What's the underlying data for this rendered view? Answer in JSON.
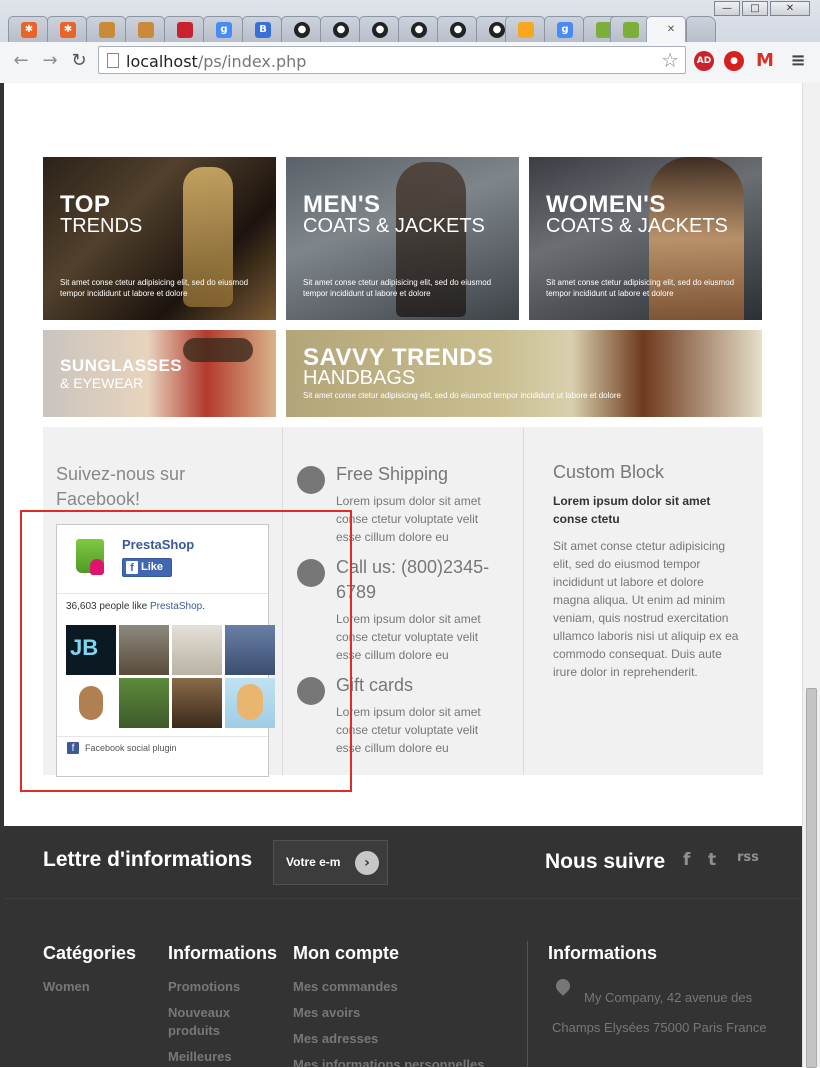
{
  "browser": {
    "url_host": "localhost",
    "url_path": "/ps/index.php",
    "tab_favicons": [
      "joomla",
      "joomla",
      "pma-folder",
      "pma-folder",
      "generic-red",
      "google",
      "blogger",
      "ghost",
      "ghost",
      "ghost",
      "ghost",
      "ghost",
      "ghost",
      "pma",
      "google",
      "android",
      "android",
      "blank"
    ],
    "window_buttons": {
      "minimize": "—",
      "maximize": "□",
      "close": "✕"
    },
    "extensions": {
      "adblock": "AD",
      "stop": "●",
      "gmail": "M",
      "menu": "≡"
    }
  },
  "banners": [
    {
      "title": "TOP",
      "subtitle": "TRENDS",
      "desc": "Sit amet conse ctetur adipisicing elit, sed do eiusmod tempor incididunt ut labore et dolore"
    },
    {
      "title": "MEN'S",
      "subtitle": "COATS & JACKETS",
      "desc": "Sit amet conse ctetur adipisicing elit, sed do eiusmod tempor incididunt ut labore et dolore"
    },
    {
      "title": "WOMEN'S",
      "subtitle": "COATS & JACKETS",
      "desc": "Sit amet conse ctetur adipisicing elit, sed do eiusmod tempor incididunt ut labore et dolore"
    },
    {
      "title": "SUNGLASSES",
      "subtitle": "& EYEWEAR"
    },
    {
      "title": "SAVVY TRENDS",
      "subtitle": "HANDBAGS",
      "desc": "Sit amet conse ctetur adipisicing elit, sed do eiusmod tempor incididunt ut labore et dolore"
    }
  ],
  "facebook": {
    "title": "Suivez-nous sur Facebook!",
    "page_name": "PrestaShop",
    "like_label": "Like",
    "count_text": "36,603 people like",
    "count_page": "PrestaShop",
    "footer": "Facebook social plugin",
    "faces": [
      "JB",
      "dog",
      "cat",
      "people",
      "toy",
      "group",
      "friends",
      "cartoon"
    ]
  },
  "services": [
    {
      "icon": "truck-icon",
      "title": "Free Shipping",
      "text": "Lorem ipsum dolor sit amet conse ctetur voluptate velit esse cillum dolore eu"
    },
    {
      "icon": "phone-icon",
      "title": "Call us: (800)2345-6789",
      "text": "Lorem ipsum dolor sit amet conse ctetur voluptate velit esse cillum dolore eu"
    },
    {
      "icon": "card-icon",
      "title": "Gift cards",
      "text": "Lorem ipsum dolor sit amet conse ctetur voluptate velit esse cillum dolore eu"
    }
  ],
  "custom_block": {
    "title": "Custom Block",
    "subtitle": "Lorem ipsum dolor sit amet conse ctetu",
    "text": "Sit amet conse ctetur adipisicing elit, sed do eiusmod tempor incididunt ut labore et dolore magna aliqua. Ut enim ad minim veniam, quis nostrud exercitation ullamco laboris nisi ut aliquip ex ea commodo consequat. Duis aute irure dolor in reprehenderit."
  },
  "newsletter": {
    "title": "Lettre d'informations",
    "input_value": "Votre e-m",
    "submit": "›"
  },
  "follow": {
    "title": "Nous suivre",
    "icons": [
      "f",
      "t",
      "rss"
    ]
  },
  "footer": {
    "categories": {
      "title": "Catégories",
      "links": [
        "Women"
      ]
    },
    "informations": {
      "title": "Informations",
      "links": [
        "Promotions",
        "Nouveaux produits",
        "Meilleures"
      ]
    },
    "account": {
      "title": "Mon compte",
      "links": [
        "Mes commandes",
        "Mes avoirs",
        "Mes adresses",
        "Mes informations personnelles"
      ]
    },
    "store": {
      "title": "Informations",
      "address": "My Company, 42 avenue des Champs Elysées 75000 Paris France"
    }
  },
  "colors": {
    "highlight_box": "#e12b2b",
    "footer_bg": "#333333",
    "fb_blue": "#3b5998"
  }
}
